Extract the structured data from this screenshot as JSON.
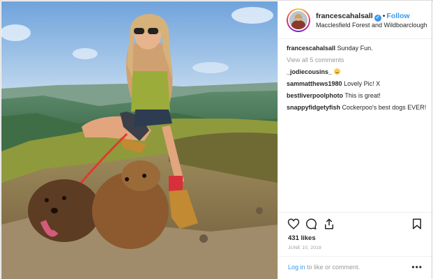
{
  "post": {
    "username": "francescahalsall",
    "verified_glyph": "✓",
    "separator": "•",
    "follow_label": "Follow",
    "location": "Macclesfield Forest and Wildboarclough",
    "caption_user": "francescahalsall",
    "caption_text": "Sunday Fun.",
    "view_all_comments": "View all 5 comments",
    "comments": [
      {
        "user": "_jodiecousins_",
        "text": "",
        "emoji": "smiling-face-icon"
      },
      {
        "user": "sammatthews1980",
        "text": "Lovely Pic! X"
      },
      {
        "user": "bestliverpoolphoto",
        "text": "This is great!"
      },
      {
        "user": "snappyfidgetyfish",
        "text": "Cockerpoo's best dogs EVER!"
      }
    ],
    "likes": "431 likes",
    "date": "JUNE 10, 2018",
    "login_link": "Log in",
    "login_suffix": " to like or comment.",
    "more_glyph": "•••"
  },
  "icons": {
    "like": "heart-icon",
    "comment": "comment-bubble-icon",
    "share": "share-icon",
    "save": "bookmark-icon"
  },
  "colors": {
    "link_blue": "#3897f0",
    "text": "#262626",
    "muted": "#999999",
    "border": "#efefef"
  }
}
